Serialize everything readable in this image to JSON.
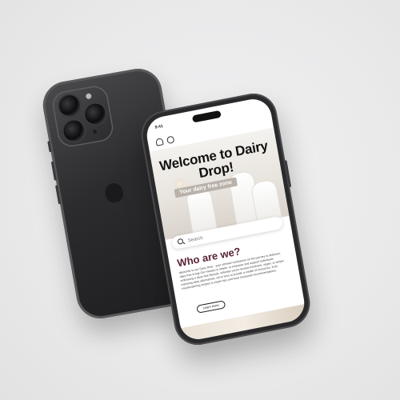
{
  "status_bar": {
    "time": "9:41"
  },
  "hero": {
    "title": "Welcome to Dairy Drop!",
    "tagline": "Your dairy free zone"
  },
  "search": {
    "placeholder": "Search"
  },
  "about": {
    "heading": "Who are we?",
    "body": "Welcome to our Dairy Drop - your ultimate companion on the journey to delicious, dairy-free living! Our mission is simple: to empower and support individuals embracing a dairy-free lifestyle. Whether you're lactose intolerant, vegan, or simply exploring dairy alternatives, we're here to provide a wealth of resources, from mouthwatering recipes to expert tips and local restaurant recommendations.",
    "button_label": "Learn more"
  },
  "icons": [
    "bell-icon",
    "profile-icon",
    "search-icon",
    "apple-logo",
    "camera-lens"
  ],
  "colors": {
    "heading_accent": "#5a2434",
    "phone_body": "#2c2c2e",
    "background": "#ececed"
  }
}
